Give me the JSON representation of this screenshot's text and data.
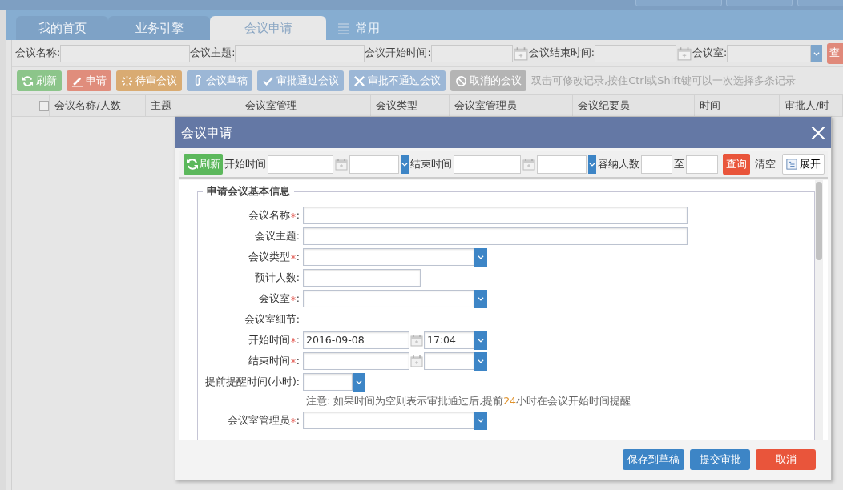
{
  "tabs": [
    {
      "label": "我的首页",
      "selected": false,
      "kind": "plain"
    },
    {
      "label": "业务引擎",
      "selected": false,
      "kind": "plain"
    },
    {
      "label": "会议申请",
      "selected": true,
      "kind": "plain"
    },
    {
      "label": "常用",
      "selected": false,
      "kind": "menu"
    }
  ],
  "filters": [
    {
      "label": "会议名称:",
      "kind": "text"
    },
    {
      "label": "会议主题:",
      "kind": "text"
    },
    {
      "label": "会议开始时间:",
      "kind": "date"
    },
    {
      "label": "会议结束时间:",
      "kind": "date"
    },
    {
      "label": "会议室:",
      "kind": "select"
    }
  ],
  "search_button": "查",
  "toolbar": [
    {
      "label": "刷新",
      "kind": "refresh",
      "color": "#8cc58a"
    },
    {
      "label": "申请",
      "kind": "edit",
      "color": "#e08d7c"
    },
    {
      "label": "待审会议",
      "kind": "pending",
      "color": "#d9ab72"
    },
    {
      "label": "会议草稿",
      "kind": "attach",
      "color": "#9cb7d6"
    },
    {
      "label": "审批通过会议",
      "kind": "approve",
      "color": "#9cb7d6"
    },
    {
      "label": "审批不通过会议",
      "kind": "reject",
      "color": "#9cb7d6"
    },
    {
      "label": "取消的会议",
      "kind": "cancel",
      "color": "#b4b4b4"
    }
  ],
  "toolbar_hint": "双击可修改记录,按住Ctrl或Shift键可以一次选择多条记录",
  "table": {
    "select_all": {
      "checked": false
    },
    "columns": [
      "会议名称/人数",
      "主题",
      "会议室管理",
      "会议类型",
      "会议室管理员",
      "会议纪要员",
      "时间",
      "审批人/时"
    ]
  },
  "dialog": {
    "title": "会议申请",
    "toolbar": {
      "refresh": "刷新",
      "start_label": "开始时间",
      "end_label": "结束时间",
      "capacity_label": "容纳人数",
      "to": "至",
      "search": "查询",
      "clear": "清空",
      "expand": "展开"
    },
    "legend": "申请会议基本信息",
    "rows": [
      {
        "label": "会议名称",
        "required": true,
        "colon": ":",
        "kind": "text_wide"
      },
      {
        "label": "会议主题",
        "required": false,
        "colon": ":",
        "kind": "text_wide"
      },
      {
        "label": "会议类型",
        "required": true,
        "colon": ":",
        "kind": "select"
      },
      {
        "label": "预计人数",
        "required": false,
        "colon": ":",
        "kind": "text_short"
      },
      {
        "label": "会议室",
        "required": true,
        "colon": ":",
        "kind": "select"
      },
      {
        "label": "会议室细节",
        "required": false,
        "colon": ":",
        "kind": "none"
      },
      {
        "label": "开始时间",
        "required": true,
        "colon": ":",
        "kind": "datetime",
        "date": "2016-09-08",
        "time": "17:04"
      },
      {
        "label": "结束时间",
        "required": true,
        "colon": ":",
        "kind": "datetime"
      },
      {
        "label": "提前提醒时间(小时)",
        "required": false,
        "colon": ":",
        "kind": "select_short"
      },
      {
        "kind": "note",
        "before": "注意: 如果时间为空则表示审批通过后,提前",
        "highlight": "24",
        "after": "小时在会议开始时间提醒"
      },
      {
        "label": "会议室管理员",
        "required": true,
        "colon": ":",
        "kind": "select"
      }
    ],
    "buttons": [
      {
        "label": "保存到草稿",
        "kind": "primary"
      },
      {
        "label": "提交审批",
        "kind": "primary"
      },
      {
        "label": "取消",
        "kind": "danger"
      }
    ]
  }
}
